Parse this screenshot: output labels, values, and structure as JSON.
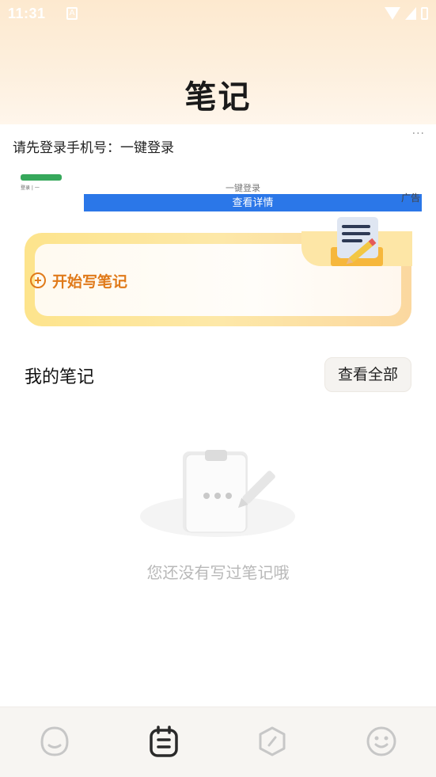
{
  "status_bar": {
    "time": "11:31",
    "notification_letter": "A"
  },
  "header": {
    "title": "笔记"
  },
  "ad": {
    "text": "请先登录手机号：一键登录",
    "more": "···",
    "thumb_caption": "登录 | 一",
    "faint_text": "一键登录",
    "banner_label": "查看详情",
    "tag": "广告"
  },
  "write_card": {
    "label": "开始写笔记"
  },
  "notes_section": {
    "title": "我的笔记",
    "view_all": "查看全部"
  },
  "empty_state": {
    "message": "您还没有写过笔记哦"
  },
  "tabbar": {
    "tabs": [
      {
        "icon": "face-tab-icon",
        "active": false
      },
      {
        "icon": "notebook-tab-icon",
        "active": true
      },
      {
        "icon": "compass-tab-icon",
        "active": false
      },
      {
        "icon": "smiley-tab-icon",
        "active": false
      }
    ]
  },
  "colors": {
    "accent_orange": "#e07a1a",
    "card_yellow": "#fde48c",
    "ad_banner_blue": "#2b77e8",
    "tab_inactive": "#c7c7c7",
    "tab_active": "#2a2a2a"
  }
}
